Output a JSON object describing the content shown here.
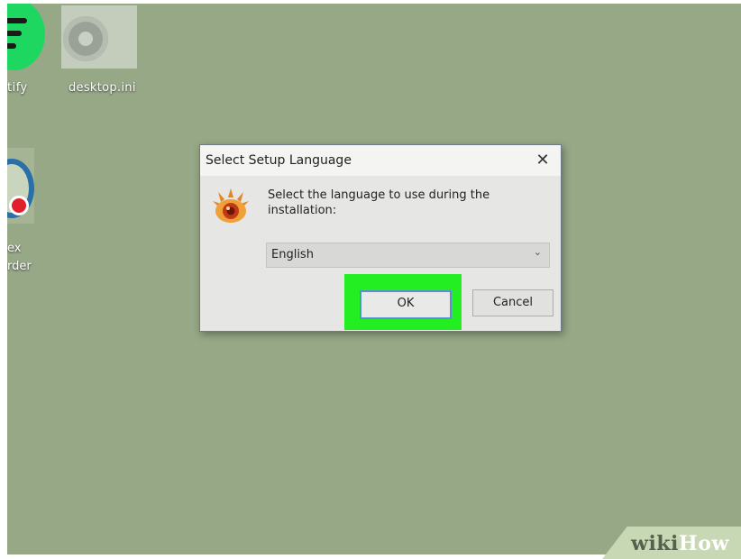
{
  "desktop": {
    "icons": [
      {
        "label": "tify"
      },
      {
        "label": "desktop.ini"
      },
      {
        "label_lines": [
          "ex",
          "rder"
        ]
      }
    ]
  },
  "dialog": {
    "title": "Select Setup Language",
    "close_glyph": "✕",
    "app_icon": "eye-logo-icon",
    "message": "Select the language to use during the installation:",
    "language_select": {
      "value": "English"
    },
    "ok_label": "OK",
    "cancel_label": "Cancel"
  },
  "highlight_color": "#22ee22",
  "watermark": {
    "part1": "wiki",
    "part2": "How"
  }
}
